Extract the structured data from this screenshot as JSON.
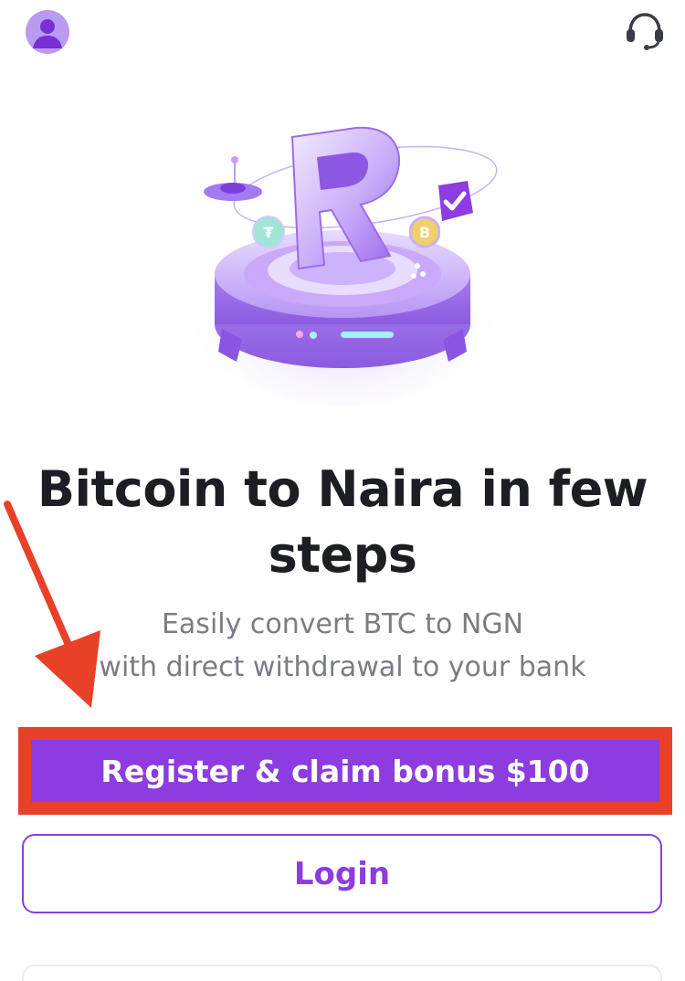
{
  "header": {
    "avatar_icon": "user-avatar-icon",
    "support_icon": "headset-support-icon"
  },
  "hero": {
    "illustration": "crypto-platform-logo-illustration",
    "coin_icons": [
      "tether-coin-icon",
      "bitcoin-coin-icon",
      "checkmark-badge-icon"
    ]
  },
  "main": {
    "title": "Bitcoin to Naira in few steps",
    "subtitle_line1": "Easily convert BTC to NGN",
    "subtitle_line2": "with direct withdrawal to your bank"
  },
  "actions": {
    "register_label": "Register & claim bonus $100",
    "login_label": "Login"
  },
  "colors": {
    "brand_purple": "#8c3ce0",
    "highlight_red": "#e84128",
    "title_text": "#1d1d24",
    "subtitle_text": "#7b7d84"
  }
}
